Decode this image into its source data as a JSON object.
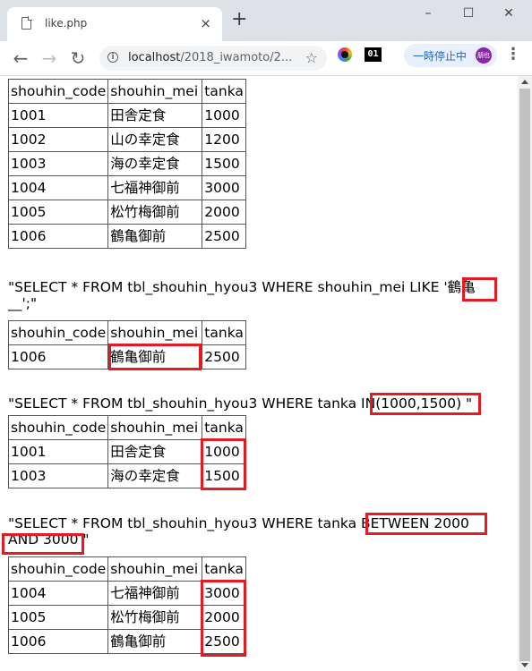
{
  "browser": {
    "tab_title": "like.php",
    "url_host": "localhost",
    "url_path": "/2018_iwamoto/2...",
    "pause_label": "一時停止中",
    "avatar_text": "朋也",
    "ext2_label": "01",
    "icons": {
      "tab_close": "×",
      "new_tab": "+",
      "minimize": "–",
      "maximize": "☐",
      "close": "✕",
      "back": "←",
      "forward": "→",
      "reload": "↻",
      "star": "☆",
      "menu": "⋮"
    }
  },
  "tables": {
    "t1": {
      "header": [
        "shouhin_code",
        "shouhin_mei",
        "tanka"
      ],
      "rows": [
        [
          "1001",
          "田舎定食",
          "1000"
        ],
        [
          "1002",
          "山の幸定食",
          "1200"
        ],
        [
          "1003",
          "海の幸定食",
          "1500"
        ],
        [
          "1004",
          "七福神御前",
          "3000"
        ],
        [
          "1005",
          "松竹梅御前",
          "2000"
        ],
        [
          "1006",
          "鶴亀御前",
          "2500"
        ]
      ]
    },
    "t2": {
      "header": [
        "shouhin_code",
        "shouhin_mei",
        "tanka"
      ],
      "rows": [
        [
          "1006",
          "鶴亀御前",
          "2500"
        ]
      ]
    },
    "t3": {
      "header": [
        "shouhin_code",
        "shouhin_mei",
        "tanka"
      ],
      "rows": [
        [
          "1001",
          "田舎定食",
          "1000"
        ],
        [
          "1003",
          "海の幸定食",
          "1500"
        ]
      ]
    },
    "t4": {
      "header": [
        "shouhin_code",
        "shouhin_mei",
        "tanka"
      ],
      "rows": [
        [
          "1004",
          "七福神御前",
          "3000"
        ],
        [
          "1005",
          "松竹梅御前",
          "2000"
        ],
        [
          "1006",
          "鶴亀御前",
          "2500"
        ]
      ]
    }
  },
  "queries": {
    "q1_line1": "\"SELECT * FROM tbl_shouhin_hyou3 WHERE shouhin_mei LIKE '鶴亀",
    "q1_line2": "__';\"",
    "q2_line1": "\"SELECT * FROM tbl_shouhin_hyou3 WHERE tanka IN(1000,1500) \"",
    "q3_line1": "\"SELECT * FROM tbl_shouhin_hyou3 WHERE tanka BETWEEN 2000",
    "q3_line2": "AND 3000 \""
  },
  "colors": {
    "highlight": "#e31b23",
    "table_border": "#555555"
  }
}
